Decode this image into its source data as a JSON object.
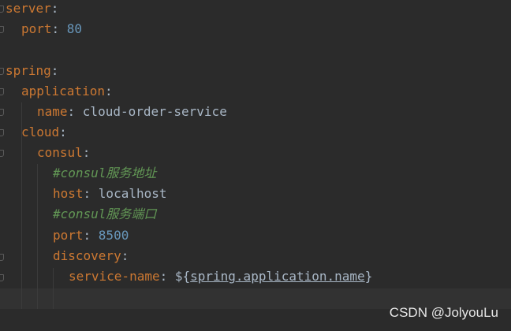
{
  "editor": {
    "lines": {
      "l1": {
        "key": "server"
      },
      "l2": {
        "key": "port",
        "value": "80"
      },
      "l4": {
        "key": "spring"
      },
      "l5": {
        "key": "application"
      },
      "l6": {
        "key": "name",
        "value": "cloud-order-service"
      },
      "l7": {
        "key": "cloud"
      },
      "l8": {
        "key": "consul"
      },
      "l9": {
        "comment": "#consul服务地址"
      },
      "l10": {
        "key": "host",
        "value": "localhost"
      },
      "l11": {
        "comment": "#consul服务端口"
      },
      "l12": {
        "key": "port",
        "value": "8500"
      },
      "l13": {
        "key": "discovery"
      },
      "l14": {
        "key": "service-name",
        "prefix": "${",
        "ref": "spring.application.name",
        "suffix": "}"
      }
    },
    "colors": {
      "background": "#2b2b2b",
      "key": "#cc7832",
      "number": "#6897bb",
      "comment": "#629755",
      "text": "#a9b7c6"
    }
  },
  "watermark": {
    "text": "CSDN @JolyouLu"
  }
}
